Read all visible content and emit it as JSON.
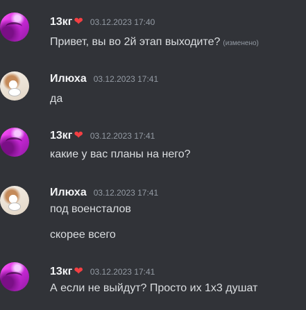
{
  "colors": {
    "background": "#313338",
    "username": "#f2f3f5",
    "message_text": "#dbdee1",
    "timestamp": "#949ba4",
    "heart": "#f23f43"
  },
  "messages": [
    {
      "author": "13кг",
      "author_icon": "red-heart-icon",
      "heart": "❤",
      "timestamp": "03.12.2023 17:40",
      "lines": [
        "Привет, вы во 2й этап выходите?"
      ],
      "edited_label": "(изменено)"
    },
    {
      "author": "Илюха",
      "timestamp": "03.12.2023 17:41",
      "lines": [
        "да"
      ]
    },
    {
      "author": "13кг",
      "author_icon": "red-heart-icon",
      "heart": "❤",
      "timestamp": "03.12.2023 17:41",
      "lines": [
        "какие у вас планы на него?"
      ]
    },
    {
      "author": "Илюха",
      "timestamp": "03.12.2023 17:41",
      "lines": [
        "под военсталов",
        "скорее всего"
      ]
    },
    {
      "author": "13кг",
      "author_icon": "red-heart-icon",
      "heart": "❤",
      "timestamp": "03.12.2023 17:41",
      "lines": [
        "А если не выйдут? Просто их 1х3 душат"
      ]
    }
  ]
}
